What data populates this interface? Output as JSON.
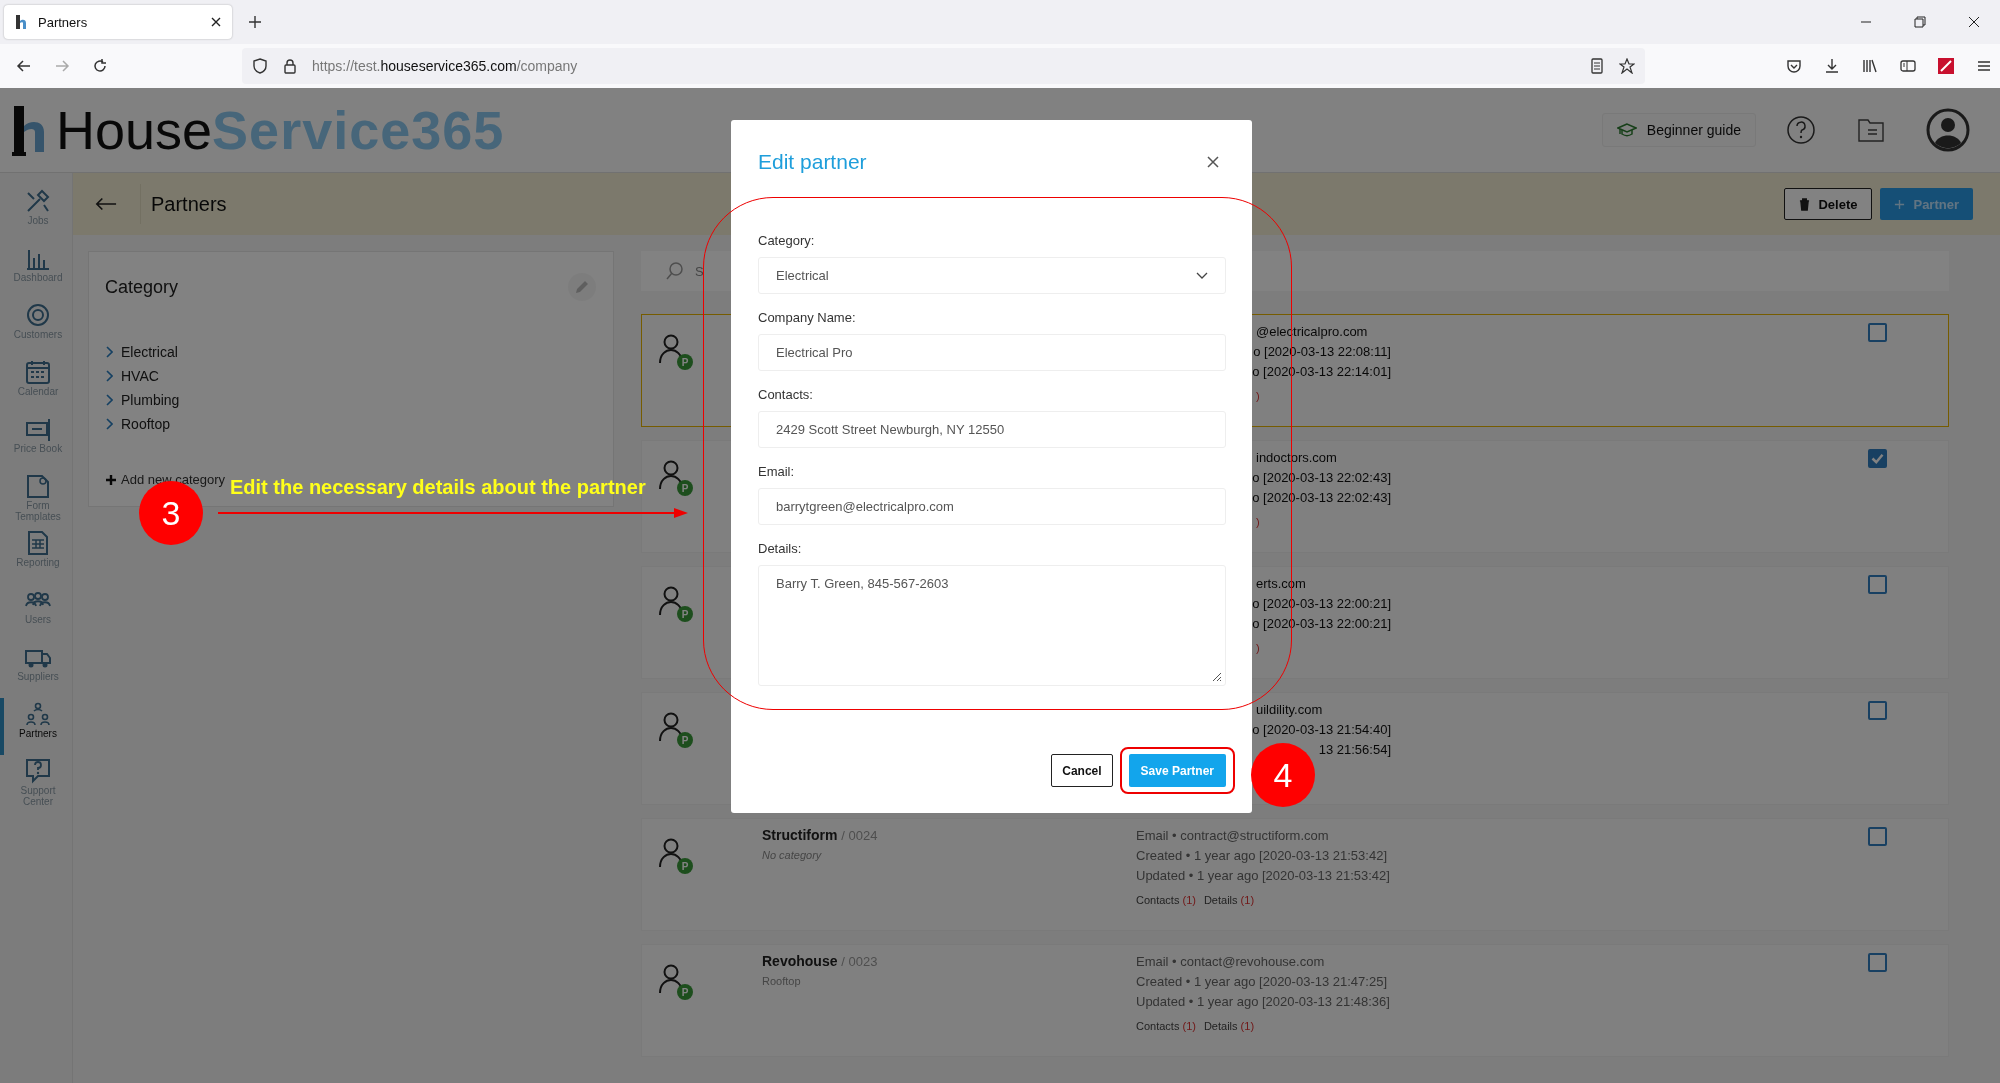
{
  "browser": {
    "tab": {
      "title": "Partners"
    },
    "url": {
      "scheme": "https://test.",
      "domain": "houseservice365.com",
      "path": "/company"
    }
  },
  "header": {
    "logo": {
      "part_1": "House",
      "part_2": "Service365"
    },
    "guide_button": "Beginner guide"
  },
  "sidebar": {
    "items": [
      {
        "label": "Jobs",
        "selected": false
      },
      {
        "label": "Dashboard",
        "selected": false
      },
      {
        "label": "Customers",
        "selected": false
      },
      {
        "label": "Calendar",
        "selected": false
      },
      {
        "label": "Price Book",
        "selected": false
      },
      {
        "label": "Form Templates",
        "selected": false
      },
      {
        "label": "Reporting",
        "selected": false
      },
      {
        "label": "Users",
        "selected": false
      },
      {
        "label": "Suppliers",
        "selected": false
      },
      {
        "label": "Partners",
        "selected": true
      },
      {
        "label": "Support Center",
        "selected": false
      }
    ]
  },
  "page": {
    "title": "Partners",
    "delete_button": "Delete",
    "add_button": "Partner"
  },
  "categories": {
    "title": "Category",
    "items": [
      {
        "label": "Electrical"
      },
      {
        "label": "HVAC"
      },
      {
        "label": "Plumbing"
      },
      {
        "label": "Rooftop"
      }
    ],
    "add_label": "Add new category"
  },
  "search": {
    "placeholder": "S"
  },
  "partners": [
    {
      "kind": "covered",
      "selected": true,
      "checked": false,
      "badge": "P",
      "info": [
        "@electricalpro.com",
        "o [2020-03-13 22:08:11]",
        "o [2020-03-13 22:14:01]"
      ],
      "links_tail": ")"
    },
    {
      "kind": "covered",
      "selected": false,
      "checked": true,
      "badge": "P",
      "info": [
        "indoctors.com",
        "o [2020-03-13 22:02:43]",
        "o [2020-03-13 22:02:43]"
      ],
      "links_tail": ")"
    },
    {
      "kind": "covered",
      "selected": false,
      "checked": false,
      "badge": "P",
      "info": [
        "erts.com",
        "o [2020-03-13 22:00:21]",
        "o [2020-03-13 22:00:21]"
      ],
      "links_tail": ")"
    },
    {
      "kind": "covered",
      "selected": false,
      "checked": false,
      "badge": "P",
      "info": [
        "uildility.com",
        "o [2020-03-13 21:54:40]",
        "13 21:56:54]"
      ]
    },
    {
      "kind": "full",
      "selected": false,
      "checked": false,
      "badge": "P",
      "name": "Structiform",
      "number": "/ 0024",
      "category": "No category",
      "uncategorized": true,
      "info": [
        "Email • contract@structiform.com",
        "Created • 1 year ago [2020-03-13 21:53:42]",
        "Updated • 1 year ago [2020-03-13 21:53:42]"
      ],
      "links": [
        {
          "label": "Contacts",
          "count": "(1)"
        },
        {
          "label": "Details",
          "count": "(1)"
        }
      ]
    },
    {
      "kind": "full",
      "selected": false,
      "checked": false,
      "badge": "P",
      "name": "Revohouse",
      "number": "/ 0023",
      "category": "Rooftop",
      "uncategorized": false,
      "info": [
        "Email • contact@revohouse.com",
        "Created • 1 year ago [2020-03-13 21:47:25]",
        "Updated • 1 year ago [2020-03-13 21:48:36]"
      ],
      "links": [
        {
          "label": "Contacts",
          "count": "(1)"
        },
        {
          "label": "Details",
          "count": "(1)"
        }
      ]
    }
  ],
  "modal": {
    "title": "Edit partner",
    "fields": [
      {
        "kind": "select",
        "label": "Category:",
        "value": "Electrical"
      },
      {
        "kind": "text",
        "label": "Company Name:",
        "value": "Electrical Pro"
      },
      {
        "kind": "text",
        "label": "Contacts:",
        "value": "2429 Scott Street Newburgh, NY 12550"
      },
      {
        "kind": "text",
        "label": "Email:",
        "value": "barrytgreen@electricalpro.com"
      },
      {
        "kind": "textarea",
        "label": "Details:",
        "value": "Barry T. Green, 845-567-2603"
      }
    ],
    "cancel": "Cancel",
    "save": "Save Partner"
  },
  "annotations": [
    {
      "number": "3",
      "text": "Edit the necessary details about the partner"
    },
    {
      "number": "4"
    }
  ]
}
